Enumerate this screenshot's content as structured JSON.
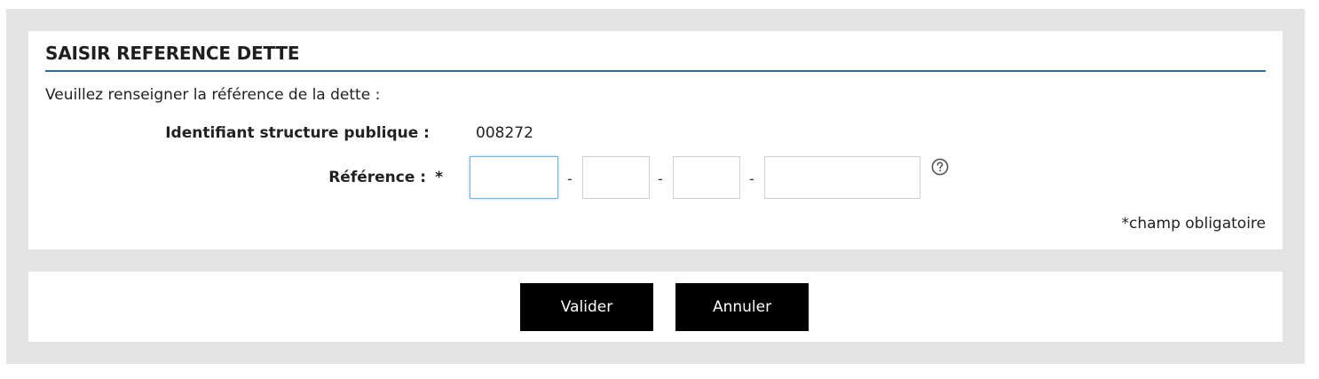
{
  "form": {
    "title": "SAISIR REFERENCE DETTE",
    "intro": "Veuillez renseigner la référence de la dette :",
    "identifiant_label": "Identifiant structure publique :",
    "identifiant_value": "008272",
    "reference_label": "Référence :",
    "required_marker": "*",
    "separator": "-",
    "reference_fields": [
      "",
      "",
      "",
      ""
    ],
    "mandatory_note": "*champ obligatoire",
    "help_icon": "question-circle-icon"
  },
  "actions": {
    "valider_label": "Valider",
    "annuler_label": "Annuler"
  },
  "colors": {
    "background_frame": "#e3e3e3",
    "title_rule": "#2f6f8f",
    "button_bg": "#000000",
    "button_text": "#ffffff",
    "focus_border": "#7fb3d9"
  }
}
